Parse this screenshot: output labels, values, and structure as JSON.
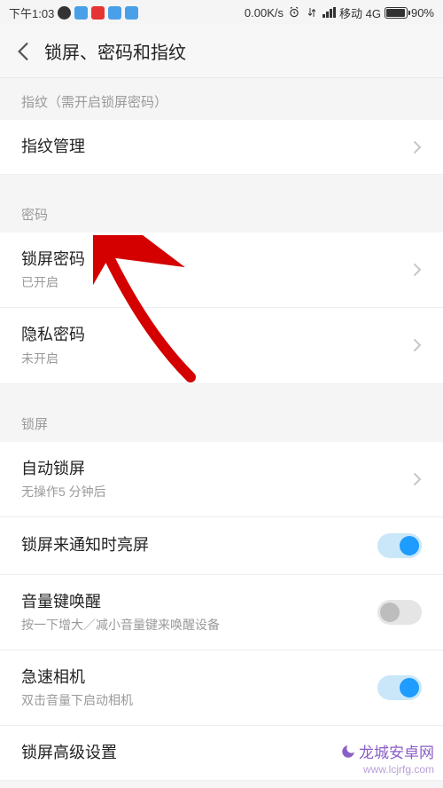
{
  "status": {
    "time": "下午1:03",
    "speed": "0.00K/s",
    "carrier": "移动 4G",
    "battery": "90%"
  },
  "header": {
    "title": "锁屏、密码和指纹"
  },
  "sections": {
    "fingerprint": {
      "header": "指纹（需开启锁屏密码）",
      "items": {
        "manage": {
          "title": "指纹管理"
        }
      }
    },
    "password": {
      "header": "密码",
      "items": {
        "lockscreen_pw": {
          "title": "锁屏密码",
          "sub": "已开启"
        },
        "privacy_pw": {
          "title": "隐私密码",
          "sub": "未开启"
        }
      }
    },
    "lockscreen": {
      "header": "锁屏",
      "items": {
        "auto_lock": {
          "title": "自动锁屏",
          "sub": "无操作5 分钟后"
        },
        "wake_notify": {
          "title": "锁屏来通知时亮屏",
          "toggle": true
        },
        "volume_wake": {
          "title": "音量键唤醒",
          "sub": "按一下增大／减小音量键来唤醒设备",
          "toggle": false
        },
        "quick_camera": {
          "title": "急速相机",
          "sub": "双击音量下启动相机",
          "toggle": true
        },
        "advanced": {
          "title": "锁屏高级设置"
        }
      }
    }
  },
  "watermark": {
    "line1": "龙城安卓网",
    "line2": "www.lcjrfg.com"
  },
  "annotation": {
    "type": "arrow",
    "target": "锁屏密码"
  }
}
